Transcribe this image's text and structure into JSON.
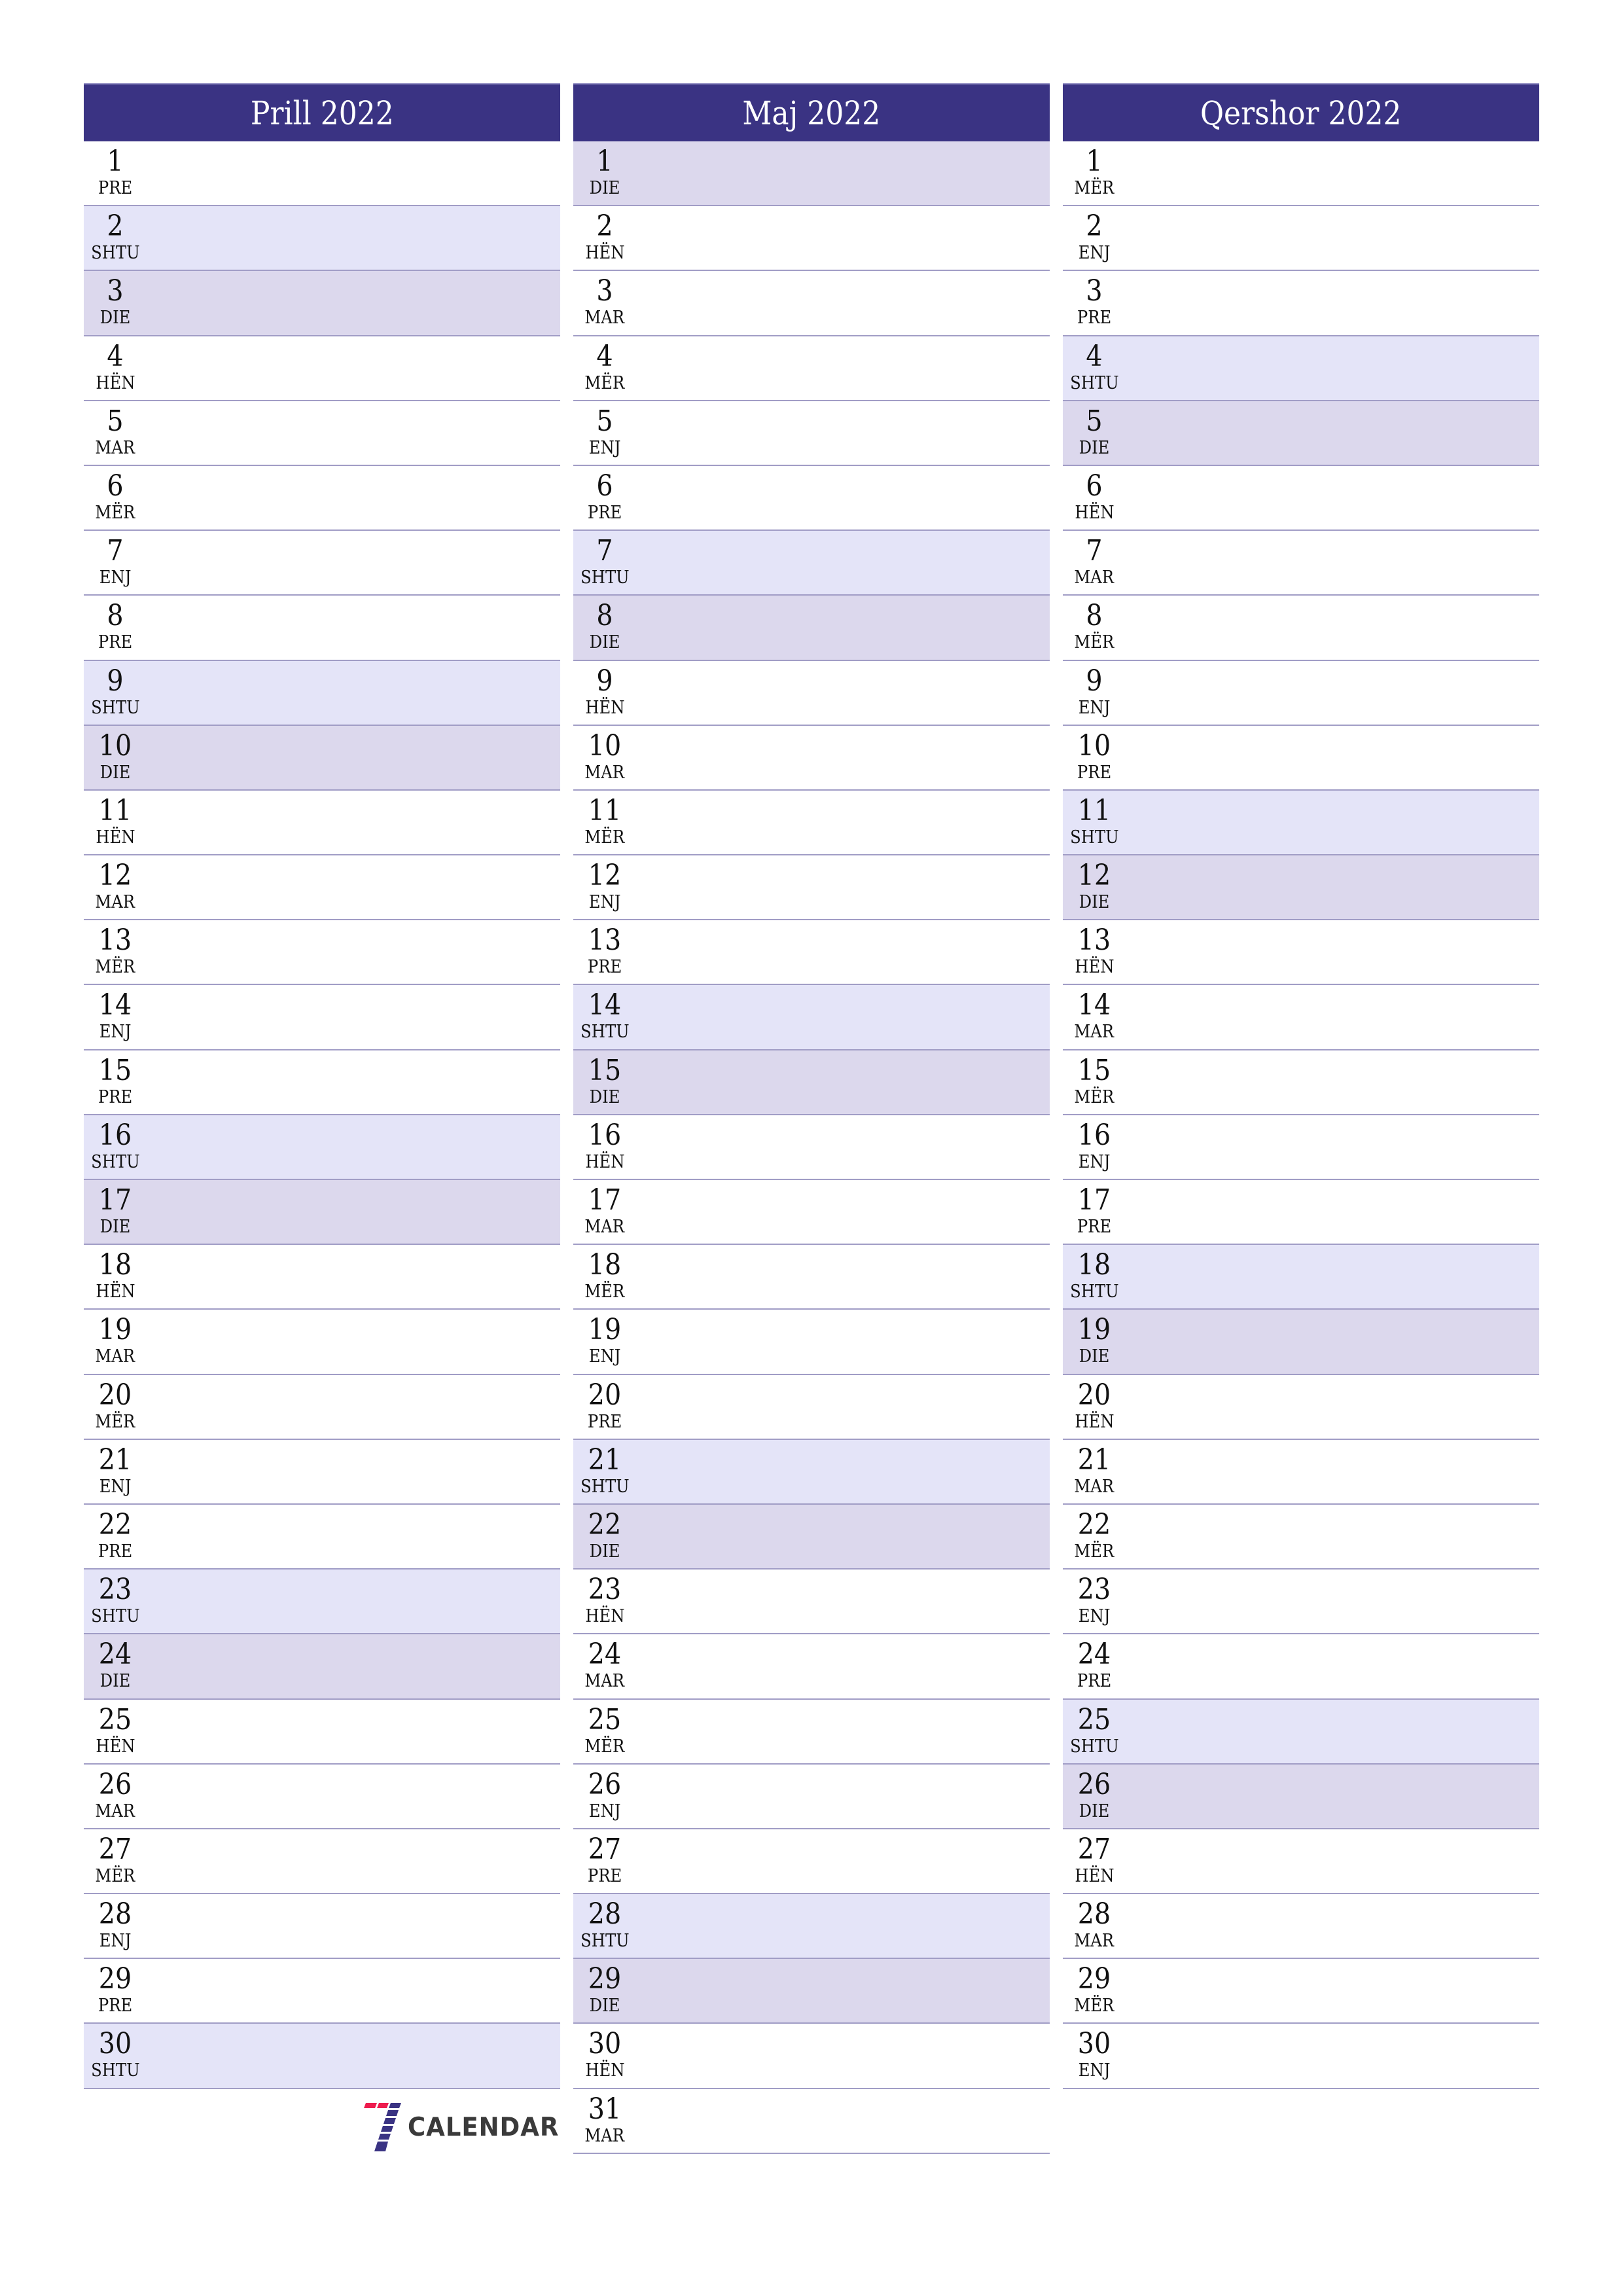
{
  "months": [
    {
      "title": "Prill 2022",
      "days": [
        {
          "num": "1",
          "name": "PRE"
        },
        {
          "num": "2",
          "name": "SHTU"
        },
        {
          "num": "3",
          "name": "DIE"
        },
        {
          "num": "4",
          "name": "HËN"
        },
        {
          "num": "5",
          "name": "MAR"
        },
        {
          "num": "6",
          "name": "MËR"
        },
        {
          "num": "7",
          "name": "ENJ"
        },
        {
          "num": "8",
          "name": "PRE"
        },
        {
          "num": "9",
          "name": "SHTU"
        },
        {
          "num": "10",
          "name": "DIE"
        },
        {
          "num": "11",
          "name": "HËN"
        },
        {
          "num": "12",
          "name": "MAR"
        },
        {
          "num": "13",
          "name": "MËR"
        },
        {
          "num": "14",
          "name": "ENJ"
        },
        {
          "num": "15",
          "name": "PRE"
        },
        {
          "num": "16",
          "name": "SHTU"
        },
        {
          "num": "17",
          "name": "DIE"
        },
        {
          "num": "18",
          "name": "HËN"
        },
        {
          "num": "19",
          "name": "MAR"
        },
        {
          "num": "20",
          "name": "MËR"
        },
        {
          "num": "21",
          "name": "ENJ"
        },
        {
          "num": "22",
          "name": "PRE"
        },
        {
          "num": "23",
          "name": "SHTU"
        },
        {
          "num": "24",
          "name": "DIE"
        },
        {
          "num": "25",
          "name": "HËN"
        },
        {
          "num": "26",
          "name": "MAR"
        },
        {
          "num": "27",
          "name": "MËR"
        },
        {
          "num": "28",
          "name": "ENJ"
        },
        {
          "num": "29",
          "name": "PRE"
        },
        {
          "num": "30",
          "name": "SHTU"
        }
      ]
    },
    {
      "title": "Maj 2022",
      "days": [
        {
          "num": "1",
          "name": "DIE"
        },
        {
          "num": "2",
          "name": "HËN"
        },
        {
          "num": "3",
          "name": "MAR"
        },
        {
          "num": "4",
          "name": "MËR"
        },
        {
          "num": "5",
          "name": "ENJ"
        },
        {
          "num": "6",
          "name": "PRE"
        },
        {
          "num": "7",
          "name": "SHTU"
        },
        {
          "num": "8",
          "name": "DIE"
        },
        {
          "num": "9",
          "name": "HËN"
        },
        {
          "num": "10",
          "name": "MAR"
        },
        {
          "num": "11",
          "name": "MËR"
        },
        {
          "num": "12",
          "name": "ENJ"
        },
        {
          "num": "13",
          "name": "PRE"
        },
        {
          "num": "14",
          "name": "SHTU"
        },
        {
          "num": "15",
          "name": "DIE"
        },
        {
          "num": "16",
          "name": "HËN"
        },
        {
          "num": "17",
          "name": "MAR"
        },
        {
          "num": "18",
          "name": "MËR"
        },
        {
          "num": "19",
          "name": "ENJ"
        },
        {
          "num": "20",
          "name": "PRE"
        },
        {
          "num": "21",
          "name": "SHTU"
        },
        {
          "num": "22",
          "name": "DIE"
        },
        {
          "num": "23",
          "name": "HËN"
        },
        {
          "num": "24",
          "name": "MAR"
        },
        {
          "num": "25",
          "name": "MËR"
        },
        {
          "num": "26",
          "name": "ENJ"
        },
        {
          "num": "27",
          "name": "PRE"
        },
        {
          "num": "28",
          "name": "SHTU"
        },
        {
          "num": "29",
          "name": "DIE"
        },
        {
          "num": "30",
          "name": "HËN"
        },
        {
          "num": "31",
          "name": "MAR"
        }
      ]
    },
    {
      "title": "Qershor 2022",
      "days": [
        {
          "num": "1",
          "name": "MËR"
        },
        {
          "num": "2",
          "name": "ENJ"
        },
        {
          "num": "3",
          "name": "PRE"
        },
        {
          "num": "4",
          "name": "SHTU"
        },
        {
          "num": "5",
          "name": "DIE"
        },
        {
          "num": "6",
          "name": "HËN"
        },
        {
          "num": "7",
          "name": "MAR"
        },
        {
          "num": "8",
          "name": "MËR"
        },
        {
          "num": "9",
          "name": "ENJ"
        },
        {
          "num": "10",
          "name": "PRE"
        },
        {
          "num": "11",
          "name": "SHTU"
        },
        {
          "num": "12",
          "name": "DIE"
        },
        {
          "num": "13",
          "name": "HËN"
        },
        {
          "num": "14",
          "name": "MAR"
        },
        {
          "num": "15",
          "name": "MËR"
        },
        {
          "num": "16",
          "name": "ENJ"
        },
        {
          "num": "17",
          "name": "PRE"
        },
        {
          "num": "18",
          "name": "SHTU"
        },
        {
          "num": "19",
          "name": "DIE"
        },
        {
          "num": "20",
          "name": "HËN"
        },
        {
          "num": "21",
          "name": "MAR"
        },
        {
          "num": "22",
          "name": "MËR"
        },
        {
          "num": "23",
          "name": "ENJ"
        },
        {
          "num": "24",
          "name": "PRE"
        },
        {
          "num": "25",
          "name": "SHTU"
        },
        {
          "num": "26",
          "name": "DIE"
        },
        {
          "num": "27",
          "name": "HËN"
        },
        {
          "num": "28",
          "name": "MAR"
        },
        {
          "num": "29",
          "name": "MËR"
        },
        {
          "num": "30",
          "name": "ENJ"
        }
      ]
    }
  ],
  "weekend": {
    "saturday": "SHTU",
    "sunday": "DIE"
  },
  "colors": {
    "header_bg": "#3a3383",
    "saturday_bg": "#e4e4f8",
    "sunday_bg": "#dcd8ed",
    "divider": "#a19dc6",
    "logo_red": "#ee1c4e",
    "logo_blue": "#3a3383"
  },
  "logo": {
    "text": "CALENDAR",
    "icon": "seven-logo-icon"
  }
}
